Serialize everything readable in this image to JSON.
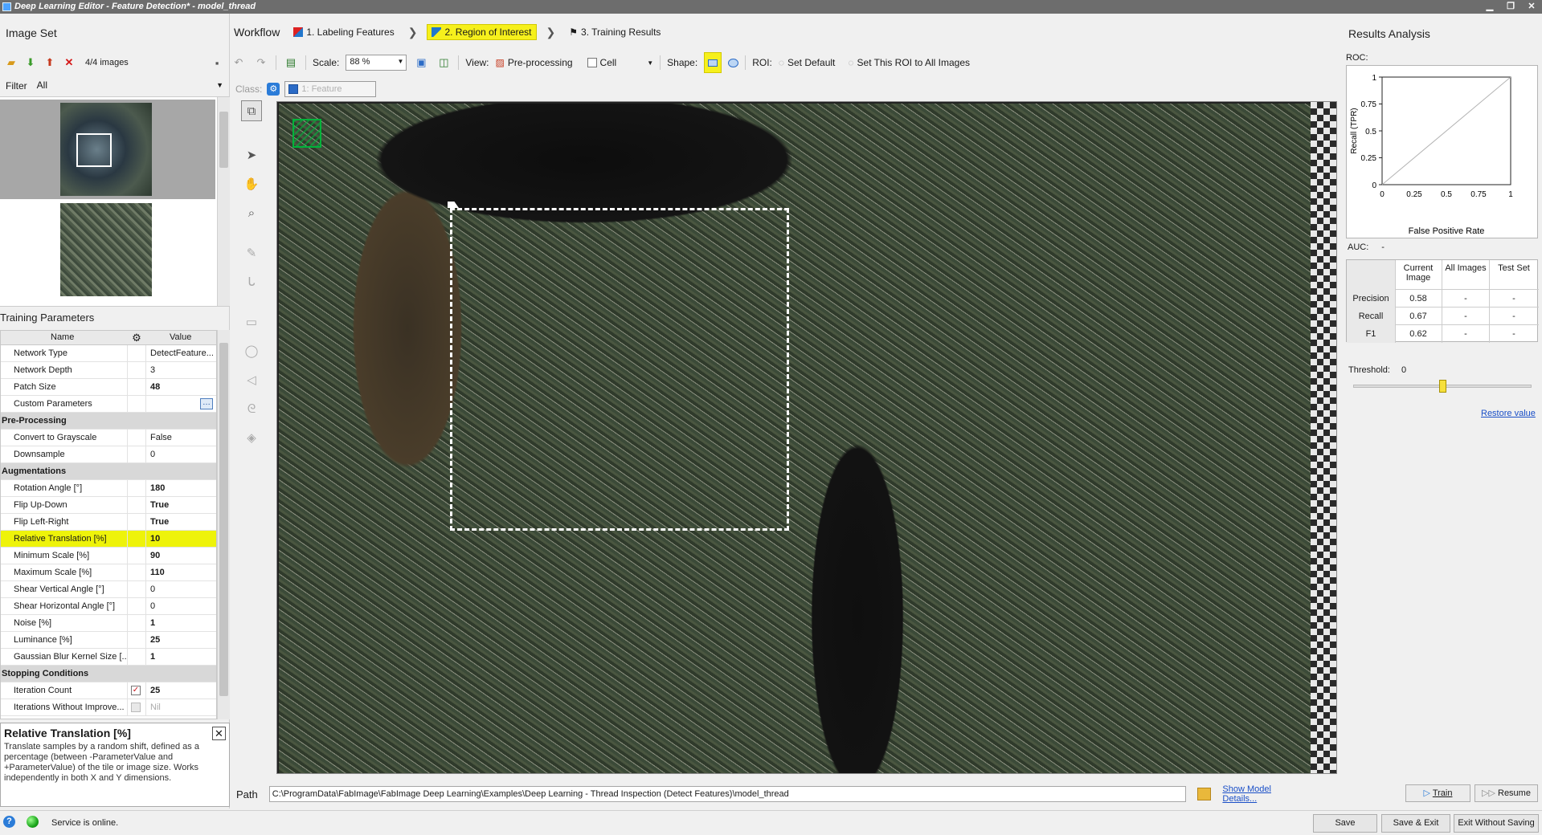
{
  "window": {
    "title": "Deep Learning Editor - Feature Detection* - model_thread",
    "minimize": "▁",
    "maximize": "❐",
    "close": "✕"
  },
  "image_set": {
    "title": "Image Set",
    "count": "4/4 images",
    "filter_label": "Filter",
    "filter_value": "All"
  },
  "training_params": {
    "title": "Training Parameters",
    "col_name": "Name",
    "col_value": "Value",
    "rows": [
      {
        "name": "Network Type",
        "value": "DetectFeature..."
      },
      {
        "name": "Network Depth",
        "value": "3"
      },
      {
        "name": "Patch Size",
        "value": "48"
      },
      {
        "name": "Custom Parameters",
        "value": ""
      },
      {
        "name": "Pre-Processing",
        "value": ""
      },
      {
        "name": "Convert to Grayscale",
        "value": "False"
      },
      {
        "name": "Downsample",
        "value": "0"
      },
      {
        "name": "Augmentations",
        "value": ""
      },
      {
        "name": "Rotation Angle [°]",
        "value": "180"
      },
      {
        "name": "Flip Up-Down",
        "value": "True"
      },
      {
        "name": "Flip Left-Right",
        "value": "True"
      },
      {
        "name": "Relative Translation [%]",
        "value": "10"
      },
      {
        "name": "Minimum Scale [%]",
        "value": "90"
      },
      {
        "name": "Maximum Scale [%]",
        "value": "110"
      },
      {
        "name": "Shear Vertical Angle [°]",
        "value": "0"
      },
      {
        "name": "Shear Horizontal Angle [°]",
        "value": "0"
      },
      {
        "name": "Noise [%]",
        "value": "1"
      },
      {
        "name": "Luminance [%]",
        "value": "25"
      },
      {
        "name": "Gaussian Blur Kernel Size [...",
        "value": "1"
      },
      {
        "name": "Stopping Conditions",
        "value": ""
      },
      {
        "name": "Iteration Count",
        "value": "25"
      },
      {
        "name": "Iterations Without Improve...",
        "value": "Nil"
      }
    ]
  },
  "help": {
    "title": "Relative Translation [%]",
    "text": "Translate samples by a random shift, defined as a percentage (between -ParameterValue and +ParameterValue) of the tile or image size. Works independently in both X and Y dimensions."
  },
  "workflow": {
    "label": "Workflow",
    "steps": [
      "1. Labeling Features",
      "2. Region of Interest",
      "3. Training Results"
    ]
  },
  "editor_toolbar": {
    "scale_label": "Scale:",
    "scale_value": "88 %",
    "view_label": "View:",
    "preprocessing": "Pre-processing",
    "cell": "Cell",
    "shape_label": "Shape:",
    "roi_label": "ROI:",
    "set_default": "Set Default",
    "set_all": "Set This ROI to All Images"
  },
  "class_bar": {
    "label": "Class:",
    "value": "1: Feature"
  },
  "path": {
    "label": "Path",
    "value": "C:\\ProgramData\\FabImage\\FabImage Deep Learning\\Examples\\Deep Learning - Thread Inspection (Detect Features)\\model_thread",
    "details_link": "Show Model Details..."
  },
  "results": {
    "title": "Results Analysis",
    "roc_label": "ROC:",
    "auc_label": "AUC:",
    "auc_value": "-",
    "roc_ylabel": "Recall (TPR)",
    "roc_xlabel": "False Positive Rate",
    "roc_xticks": [
      "0",
      "0.25",
      "0.5",
      "0.75",
      "1"
    ],
    "roc_yticks": [
      "1",
      "0.75",
      "0.5",
      "0.25",
      "0"
    ],
    "headers": [
      "Current Image",
      "All Images",
      "Test Set"
    ],
    "rows": [
      {
        "name": "Precision",
        "current": "0.58",
        "all": "-",
        "test": "-"
      },
      {
        "name": "Recall",
        "current": "0.67",
        "all": "-",
        "test": "-"
      },
      {
        "name": "F1",
        "current": "0.62",
        "all": "-",
        "test": "-"
      }
    ],
    "threshold_label": "Threshold:",
    "threshold_value": "0",
    "threshold_level": 0.5,
    "restore": "Restore value",
    "train": "Train",
    "resume": "Resume"
  },
  "status": {
    "help": "?",
    "text": "Service is online.",
    "save": "Save",
    "save_exit": "Save & Exit",
    "exit_nosave": "Exit Without Saving"
  },
  "colors": {
    "highlight": "#eef30a",
    "active_step": "#f6f01c",
    "roi": "#ffffff",
    "feature": "#00b23a",
    "link": "#1a4fc7"
  }
}
